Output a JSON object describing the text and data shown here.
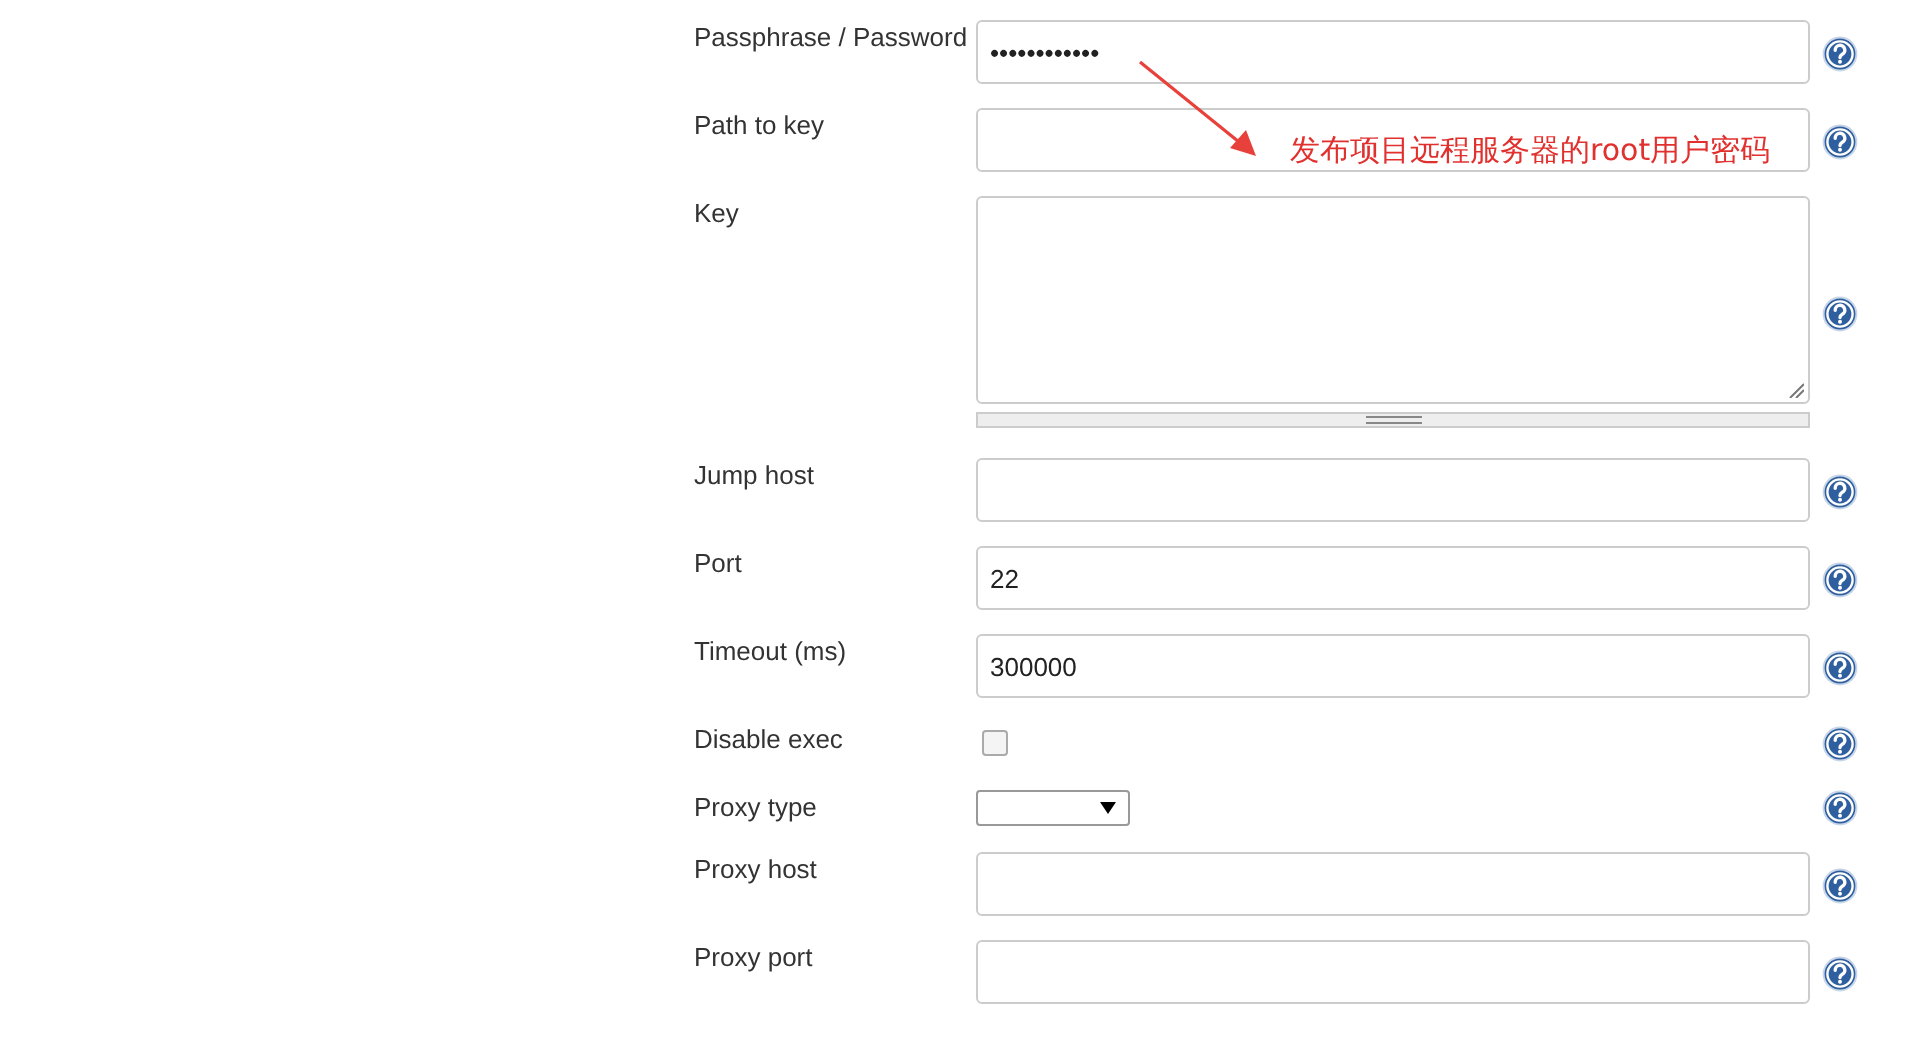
{
  "fields": [
    {
      "kind": "password",
      "label": "Passphrase / Password",
      "value": "••••••••••••"
    },
    {
      "kind": "text",
      "label": "Path to key"
    },
    {
      "kind": "textarea",
      "label": "Key"
    },
    {
      "kind": "text",
      "label": "Jump host"
    },
    {
      "kind": "text",
      "label": "Port",
      "value": "22"
    },
    {
      "kind": "text",
      "label": "Timeout (ms)",
      "value": "300000"
    },
    {
      "kind": "checkbox",
      "label": "Disable exec",
      "checked": false
    },
    {
      "kind": "select",
      "label": "Proxy type"
    },
    {
      "kind": "text",
      "label": "Proxy host"
    },
    {
      "kind": "text",
      "label": "Proxy port"
    }
  ],
  "annotation": {
    "text": "发布项目远程服务器的root用户密码"
  }
}
